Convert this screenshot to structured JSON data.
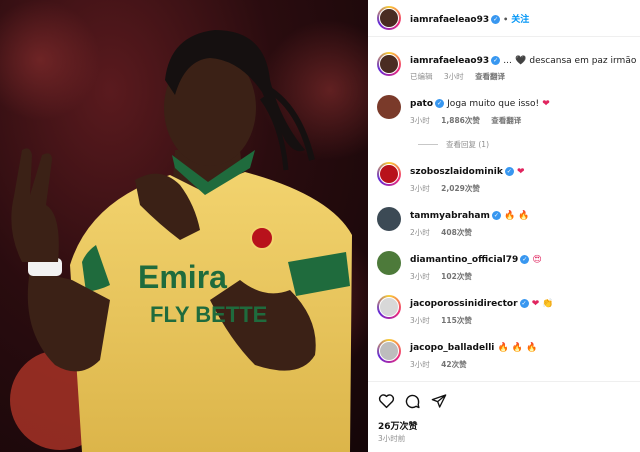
{
  "post": {
    "author": "iamrafaeleao93",
    "follow_label": "关注",
    "caption_more": "...",
    "caption_emoji": "🖤",
    "caption_text": "descansa em paz irmão",
    "caption_meta": {
      "edited": "已编辑",
      "time": "3小时",
      "translate": "查看翻译"
    },
    "likes": "26万次赞",
    "time_ago": "3小时前"
  },
  "comments": [
    {
      "user": "pato",
      "verified": true,
      "text": "Joga muito que isso!",
      "emoji": "❤",
      "time": "3小时",
      "likes": "1,886次赞",
      "translate": "查看翻译",
      "replies": "查看回复 (1)"
    },
    {
      "user": "szoboszlaidominik",
      "verified": true,
      "text": "",
      "emoji": "❤",
      "time": "3小时",
      "likes": "2,029次赞"
    },
    {
      "user": "tammyabraham",
      "verified": true,
      "text": "",
      "emoji": "🔥 🔥",
      "time": "2小时",
      "likes": "408次赞"
    },
    {
      "user": "diamantino_official79",
      "verified": true,
      "text": "",
      "emoji": "😍",
      "time": "3小时",
      "likes": "102次赞"
    },
    {
      "user": "jacoporossinidirector",
      "verified": true,
      "text": "",
      "emoji": "❤ 👏",
      "time": "3小时",
      "likes": "115次赞"
    },
    {
      "user": "jacopo_balladelli",
      "verified": false,
      "text": "",
      "emoji": "🔥 🔥 🔥",
      "time": "3小时",
      "likes": "42次赞"
    }
  ],
  "photo_text": {
    "sponsor_line1": "Emira",
    "sponsor_line2": "FLY BETTE"
  },
  "icons": [
    "heart-icon",
    "comment-icon",
    "share-icon",
    "verified-badge-icon"
  ],
  "colors": {
    "accent": "#0095f6",
    "verified": "#3897f0",
    "heart": "#e0245e",
    "jersey": "#e9c658"
  }
}
